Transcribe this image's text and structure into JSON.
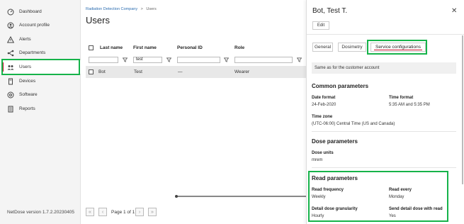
{
  "sidebar": {
    "items": [
      {
        "label": "Dashboard",
        "icon": "dashboard-icon"
      },
      {
        "label": "Account profile",
        "icon": "account-profile-icon"
      },
      {
        "label": "Alerts",
        "icon": "alert-icon"
      },
      {
        "label": "Departments",
        "icon": "departments-icon"
      },
      {
        "label": "Users",
        "icon": "users-icon"
      },
      {
        "label": "Devices",
        "icon": "devices-icon"
      },
      {
        "label": "Software",
        "icon": "software-icon"
      },
      {
        "label": "Reports",
        "icon": "reports-icon"
      }
    ],
    "active_index": 4,
    "version": "NetDose version 1.7.2.20230405"
  },
  "breadcrumb": {
    "company": "Radiation Detection Company",
    "separator": ">",
    "current": "Users"
  },
  "page_title": "Users",
  "table": {
    "columns": [
      "Last name",
      "First name",
      "Personal ID",
      "Role"
    ],
    "filters": [
      "",
      "test",
      "",
      ""
    ],
    "rows": [
      {
        "last_name": "Bot",
        "first_name": "Test",
        "personal_id": "—",
        "role": "Wearer"
      }
    ]
  },
  "pagination": {
    "text": "Page 1 of 1"
  },
  "panel": {
    "title": "Bot, Test T.",
    "edit_label": "Edit",
    "tabs": [
      "General",
      "Dosimetry",
      "Service configurations"
    ],
    "active_tab": 2,
    "note": "Same as for the customer account",
    "common": {
      "heading": "Common parameters",
      "date_format_label": "Date format",
      "date_format": "24-Feb-2020",
      "time_format_label": "Time format",
      "time_format": "5:35 AM and 5:35 PM",
      "time_zone_label": "Time zone",
      "time_zone": "(UTC-06:00) Central Time (US and Canada)"
    },
    "dose": {
      "heading": "Dose parameters",
      "units_label": "Dose units",
      "units": "mrem"
    },
    "read": {
      "heading": "Read parameters",
      "frequency_label": "Read frequency",
      "frequency": "Weekly",
      "every_label": "Read every",
      "every": "Monday",
      "granularity_label": "Detail dose granularity",
      "granularity": "Hourly",
      "send_label": "Send detail dose with read",
      "send": "Yes"
    }
  },
  "colors": {
    "highlight": "#16b34a",
    "accent": "#c8102e",
    "link": "#2b6cb0"
  }
}
